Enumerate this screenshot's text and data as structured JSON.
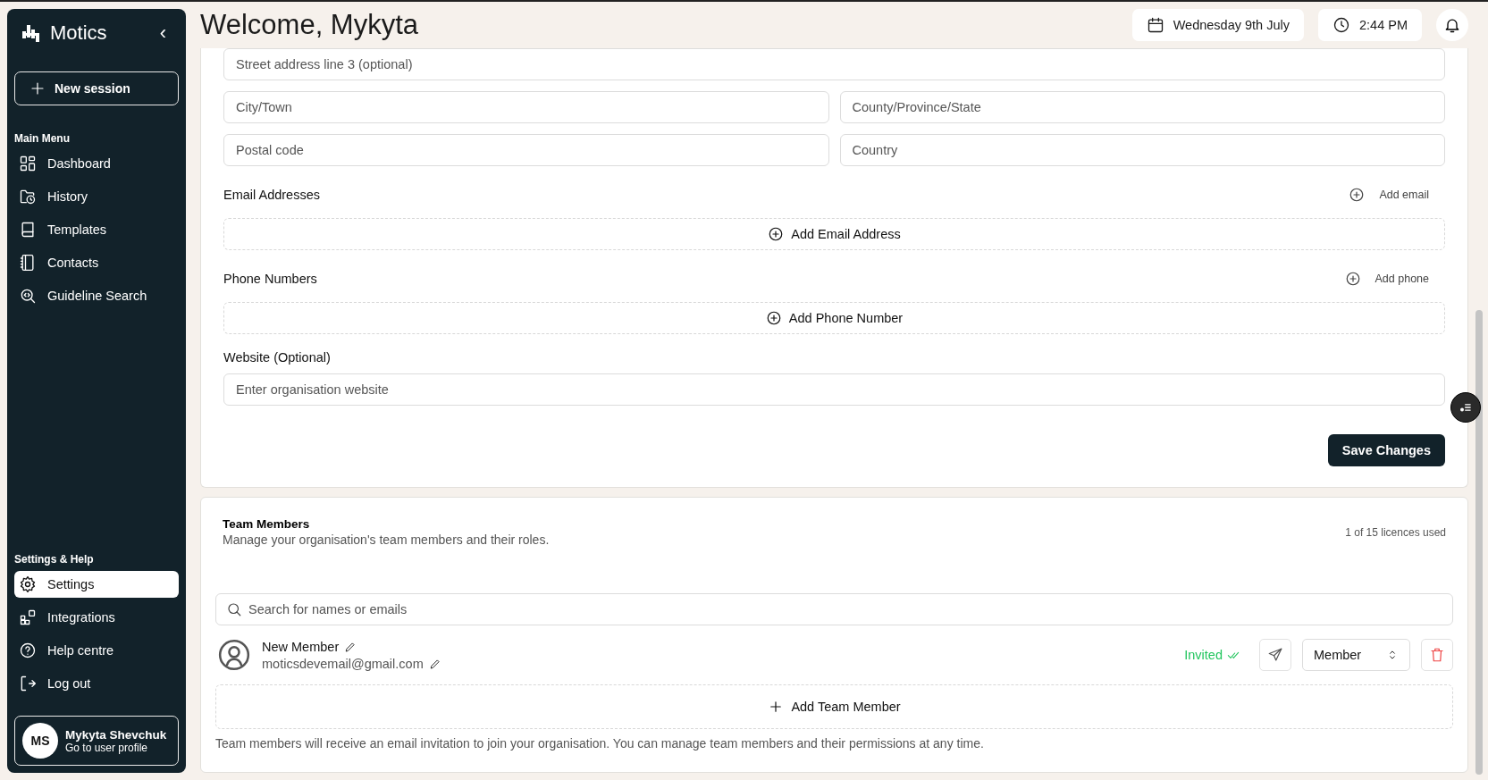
{
  "sidebar": {
    "brand": "Motics",
    "collapse_icon": "‹",
    "new_session": "New session",
    "sections": [
      {
        "heading": "Main Menu",
        "items": [
          {
            "label": "Dashboard",
            "selected": false
          },
          {
            "label": "History",
            "selected": false
          },
          {
            "label": "Templates",
            "selected": false
          },
          {
            "label": "Contacts",
            "selected": false
          },
          {
            "label": "Guideline Search",
            "selected": false
          }
        ]
      },
      {
        "heading": "Settings & Help",
        "items": [
          {
            "label": "Settings",
            "selected": true
          },
          {
            "label": "Integrations",
            "selected": false
          },
          {
            "label": "Help centre",
            "selected": false
          },
          {
            "label": "Log out",
            "selected": false
          }
        ]
      }
    ],
    "user": {
      "initials": "MS",
      "name": "Mykyta Shevchuk",
      "link": "Go to user profile"
    }
  },
  "header": {
    "title": "Welcome, Mykyta",
    "date": "Wednesday 9th July",
    "time": "2:44 PM"
  },
  "organisation": {
    "address_rows": [
      [
        {
          "placeholder": "Street address line 3 (optional)"
        }
      ],
      [
        {
          "placeholder": "City/Town"
        },
        {
          "placeholder": "County/Province/State"
        }
      ],
      [
        {
          "placeholder": "Postal code"
        },
        {
          "placeholder": "Country"
        }
      ]
    ],
    "groups": [
      {
        "label": "Email Addresses",
        "add_link": "Add email",
        "add_box": "Add Email Address"
      },
      {
        "label": "Phone Numbers",
        "add_link": "Add phone",
        "add_box": "Add Phone Number"
      }
    ],
    "website": {
      "label": "Website (Optional)",
      "placeholder": "Enter organisation website"
    },
    "save": "Save Changes"
  },
  "team": {
    "title": "Team Members",
    "subtitle": "Manage your organisation's team members and their roles.",
    "licences": "1 of 15 licences used",
    "search_placeholder": "Search for names or emails",
    "members": [
      {
        "name": "New Member",
        "email": "moticsdevemail@gmail.com",
        "status": "Invited",
        "role": "Member"
      }
    ],
    "add": "Add Team Member",
    "note": "Team members will receive an email invitation to join your organisation. You can manage team members and their permissions at any time."
  }
}
